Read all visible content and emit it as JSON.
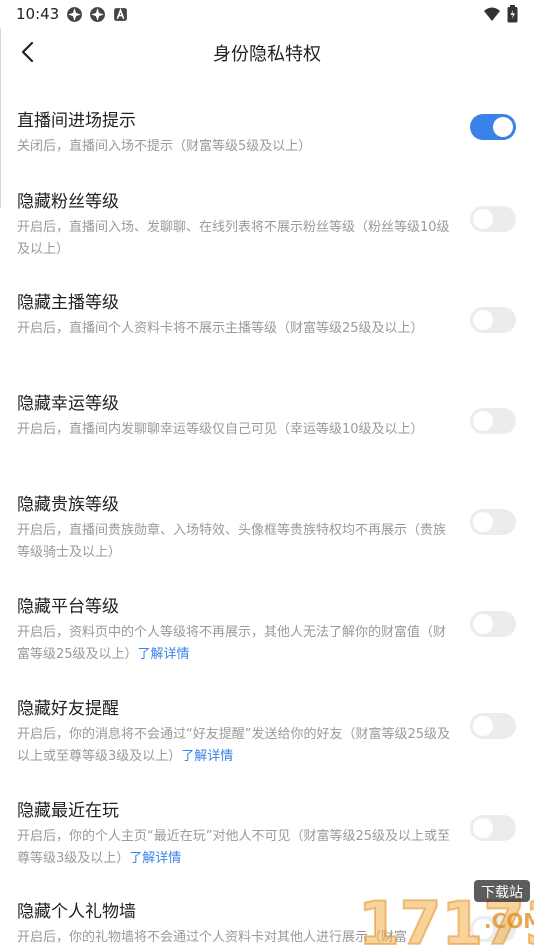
{
  "status_bar": {
    "time": "10:43"
  },
  "header": {
    "title": "身份隐私特权"
  },
  "settings": [
    {
      "title": "直播间进场提示",
      "desc": "关闭后，直播间入场不提示（财富等级5级及以上）",
      "link": "",
      "enabled": true
    },
    {
      "title": "隐藏粉丝等级",
      "desc": "开启后，直播间入场、发聊聊、在线列表将不展示粉丝等级（粉丝等级10级及以上）",
      "link": "",
      "enabled": false
    },
    {
      "title": "隐藏主播等级",
      "desc": "开启后，直播间个人资料卡将不展示主播等级（财富等级25级及以上）",
      "link": "",
      "enabled": false
    },
    {
      "title": "隐藏幸运等级",
      "desc": "开启后，直播间内发聊聊幸运等级仅自己可见（幸运等级10级及以上）",
      "link": "",
      "enabled": false
    },
    {
      "title": "隐藏贵族等级",
      "desc": "开启后，直播间贵族勋章、入场特效、头像框等贵族特权均不再展示（贵族等级骑士及以上）",
      "link": "",
      "enabled": false
    },
    {
      "title": "隐藏平台等级",
      "desc": "开启后，资料页中的个人等级将不再展示，其他人无法了解你的财富值（财富等级25级及以上）",
      "link": "了解详情",
      "enabled": false
    },
    {
      "title": "隐藏好友提醒",
      "desc": "开启后，你的消息将不会通过“好友提醒”发送给你的好友（财富等级25级及以上或至尊等级3级及以上）",
      "link": "了解详情",
      "enabled": false
    },
    {
      "title": "隐藏最近在玩",
      "desc": "开启后，你的个人主页“最近在玩”对他人不可见（财富等级25级及以上或至尊等级3级及以上）",
      "link": "了解详情",
      "enabled": false
    },
    {
      "title": "隐藏个人礼物墙",
      "desc": "开启后，你的礼物墙将不会通过个人资料卡对其他人进行展示（财富",
      "link": "",
      "enabled": false
    }
  ],
  "watermark": {
    "number": "17173",
    "site": "下载站",
    "domain": ".COM"
  }
}
